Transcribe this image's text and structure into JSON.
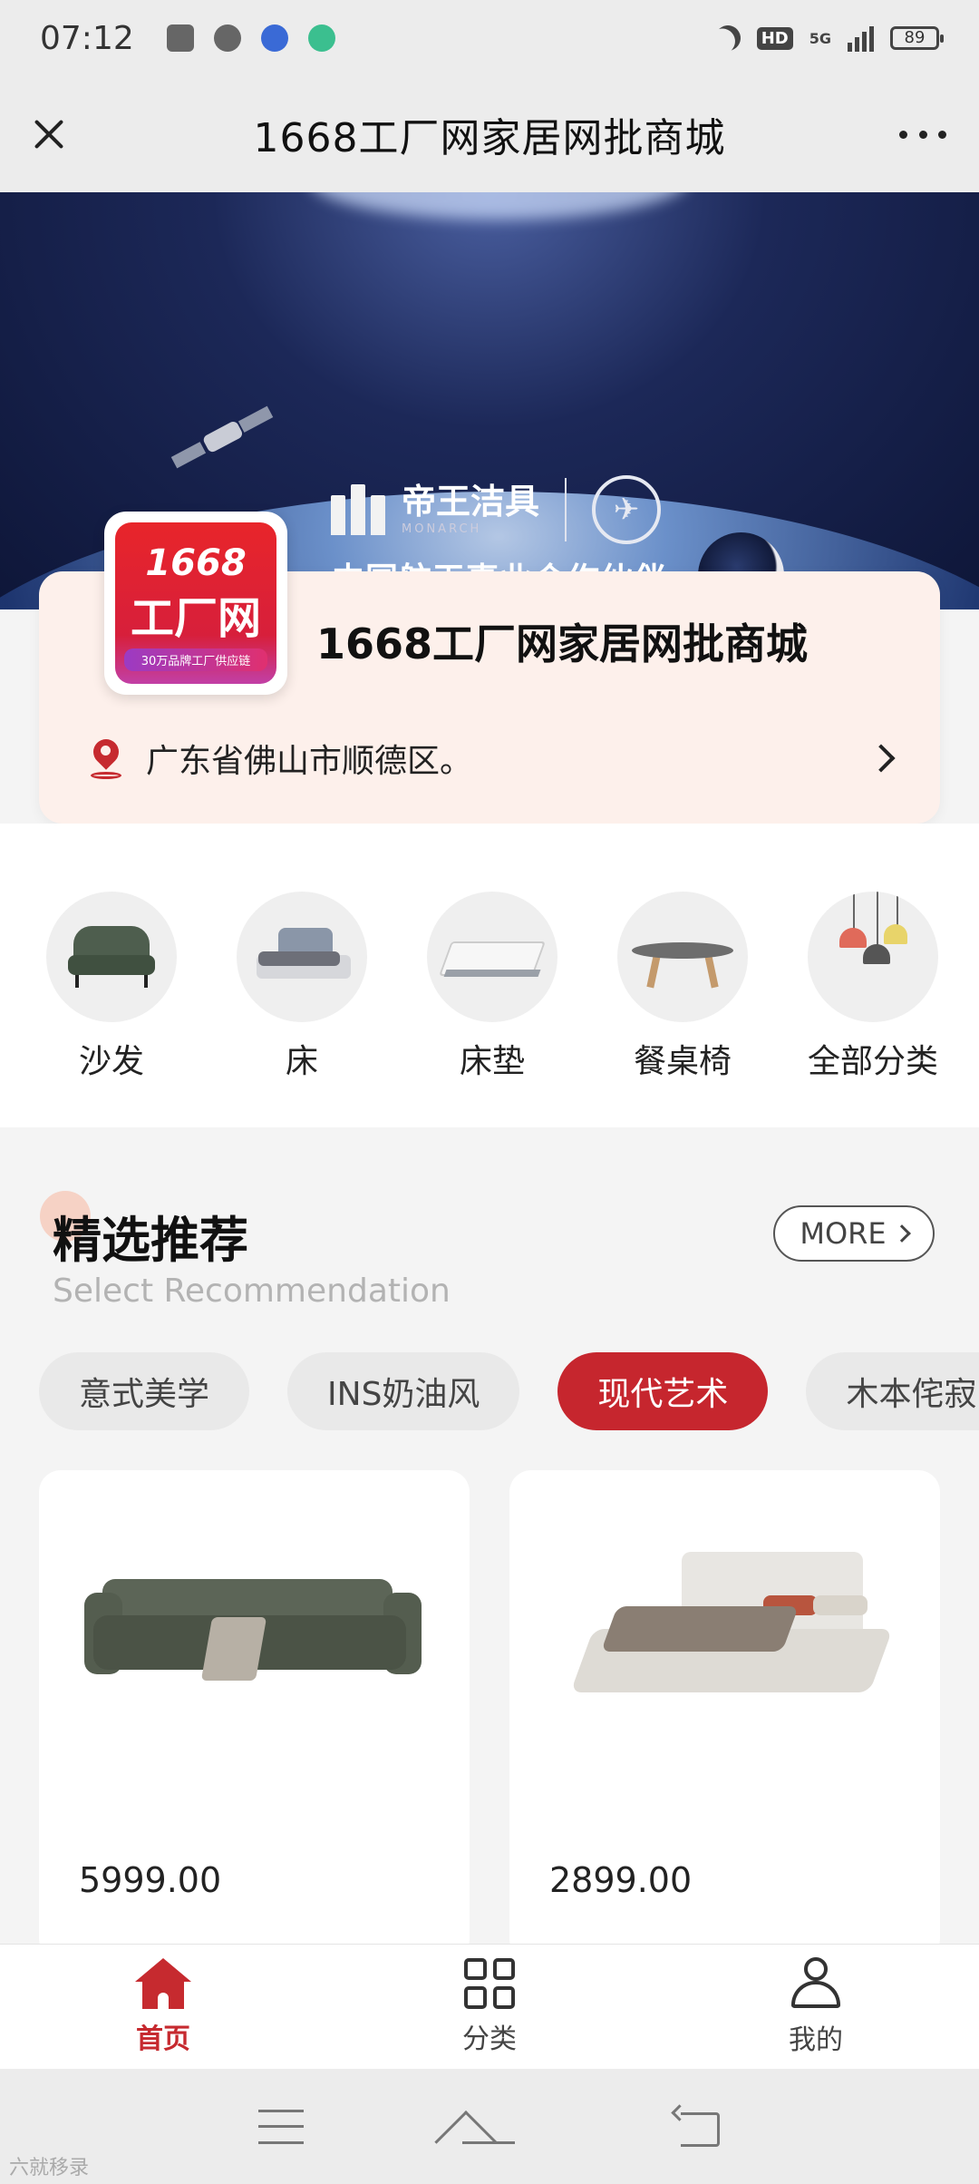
{
  "status_bar": {
    "time": "07:12",
    "hd_label": "HD",
    "network": "5G",
    "battery": "89"
  },
  "header": {
    "title": "1668工厂网家居网批商城"
  },
  "banner": {
    "brand_name": "帝王洁具",
    "brand_sub": "MONARCH",
    "slogan": "中国航天事业合作伙伴",
    "dot_count": 6,
    "active_dot": 0
  },
  "shop": {
    "logo_line1": "1668",
    "logo_line2": "工厂网",
    "logo_line3": "30万品牌工厂供应链",
    "name": "1668工厂网家居网批商城",
    "address": "广东省佛山市顺德区。"
  },
  "categories": [
    {
      "label": "沙发",
      "icon": "sofa-icon"
    },
    {
      "label": "床",
      "icon": "bed-icon"
    },
    {
      "label": "床垫",
      "icon": "mattress-icon"
    },
    {
      "label": "餐桌椅",
      "icon": "dining-table-icon"
    },
    {
      "label": "全部分类",
      "icon": "lamp-icon"
    }
  ],
  "recommend": {
    "title": "精选推荐",
    "subtitle": "Select Recommendation",
    "more_label": "MORE",
    "tags": [
      {
        "label": "意式美学",
        "active": false
      },
      {
        "label": "INS奶油风",
        "active": false
      },
      {
        "label": "现代艺术",
        "active": true
      },
      {
        "label": "木本侘寂",
        "active": false
      }
    ],
    "products": [
      {
        "price": "5999.00",
        "image": "sofa-product-image"
      },
      {
        "price": "2899.00",
        "image": "bed-product-image"
      }
    ]
  },
  "bottom_nav": [
    {
      "label": "首页",
      "icon": "home-icon",
      "active": true
    },
    {
      "label": "分类",
      "icon": "grid-icon",
      "active": false
    },
    {
      "label": "我的",
      "icon": "user-icon",
      "active": false
    }
  ],
  "watermark": "六就移录",
  "colors": {
    "accent": "#c6262e",
    "card_bg": "#fdf0eb",
    "page_bg": "#f4f4f4"
  }
}
